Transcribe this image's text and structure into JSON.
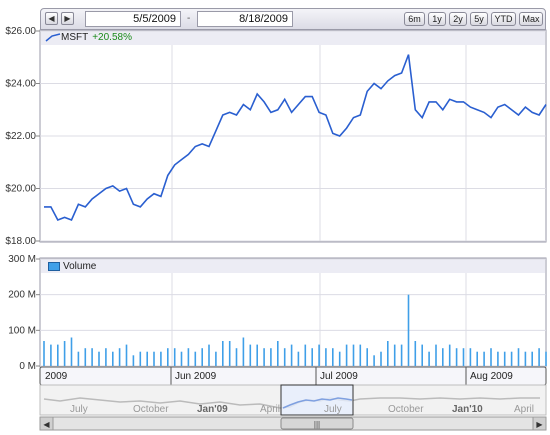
{
  "toolbar": {
    "prev_icon": "left-arrow",
    "next_icon": "right-arrow",
    "start_date": "5/5/2009",
    "end_date": "8/18/2009",
    "separator": "-",
    "ranges": [
      "6m",
      "1y",
      "2y",
      "5y",
      "YTD",
      "Max"
    ]
  },
  "colors": {
    "price_line": "#2a5fd0",
    "volume_bar": "#3f9fe8",
    "change_positive": "#1a8a1a"
  },
  "price_legend": {
    "symbol": "MSFT",
    "change": "+20.58%"
  },
  "volume_legend": {
    "label": "Volume"
  },
  "chart_data": [
    {
      "type": "line",
      "series": [
        {
          "name": "MSFT",
          "x": [
            "5/5",
            "5/6",
            "5/7",
            "5/8",
            "5/11",
            "5/12",
            "5/13",
            "5/14",
            "5/15",
            "5/18",
            "5/19",
            "5/20",
            "5/21",
            "5/22",
            "5/26",
            "5/27",
            "5/28",
            "5/29",
            "6/1",
            "6/2",
            "6/3",
            "6/4",
            "6/5",
            "6/8",
            "6/9",
            "6/10",
            "6/11",
            "6/12",
            "6/15",
            "6/16",
            "6/17",
            "6/18",
            "6/19",
            "6/22",
            "6/23",
            "6/24",
            "6/25",
            "6/26",
            "6/29",
            "6/30",
            "7/1",
            "7/2",
            "7/6",
            "7/7",
            "7/8",
            "7/9",
            "7/10",
            "7/13",
            "7/14",
            "7/15",
            "7/16",
            "7/17",
            "7/20",
            "7/21",
            "7/22",
            "7/23",
            "7/24",
            "7/27",
            "7/28",
            "7/29",
            "7/30",
            "7/31",
            "8/3",
            "8/4",
            "8/5",
            "8/6",
            "8/7",
            "8/10",
            "8/11",
            "8/12",
            "8/13",
            "8/14",
            "8/17",
            "8/18"
          ],
          "values": [
            19.3,
            19.3,
            18.8,
            18.9,
            18.8,
            19.4,
            19.3,
            19.6,
            19.8,
            20.0,
            20.1,
            19.9,
            20.0,
            19.4,
            19.3,
            19.6,
            19.8,
            19.7,
            20.5,
            20.9,
            21.1,
            21.3,
            21.6,
            21.7,
            21.6,
            22.2,
            22.8,
            22.9,
            22.8,
            23.2,
            23.0,
            23.6,
            23.3,
            22.9,
            23.0,
            23.4,
            22.9,
            23.2,
            23.5,
            23.5,
            22.9,
            22.8,
            22.1,
            22.0,
            22.3,
            22.7,
            22.8,
            23.7,
            24.0,
            23.8,
            24.1,
            24.3,
            24.4,
            25.1,
            23.0,
            22.7,
            23.3,
            23.3,
            23.0,
            23.4,
            23.3,
            23.3,
            23.1,
            23.0,
            22.9,
            22.7,
            23.1,
            23.2,
            23.0,
            22.8,
            23.1,
            22.9,
            22.8,
            23.2
          ]
        }
      ],
      "ylim": [
        18.0,
        26.0
      ],
      "ytick_labels": [
        "$18.00",
        "$20.00",
        "$22.00",
        "$24.00",
        "$26.00"
      ],
      "grid": true
    },
    {
      "type": "bar",
      "series": [
        {
          "name": "Volume",
          "values": [
            70,
            60,
            60,
            70,
            80,
            40,
            50,
            50,
            40,
            50,
            40,
            50,
            60,
            30,
            40,
            40,
            40,
            40,
            50,
            50,
            40,
            50,
            40,
            50,
            60,
            40,
            70,
            70,
            50,
            80,
            60,
            60,
            50,
            50,
            70,
            50,
            60,
            40,
            60,
            50,
            60,
            50,
            50,
            40,
            60,
            60,
            60,
            50,
            30,
            40,
            70,
            60,
            60,
            200,
            70,
            60,
            40,
            60,
            50,
            60,
            50,
            50,
            50,
            40,
            40,
            50,
            40,
            40,
            40,
            50,
            40,
            40,
            50,
            40
          ]
        }
      ],
      "ylim": [
        0,
        300
      ],
      "ytick_labels": [
        "0 M",
        "100 M",
        "200 M",
        "300 M"
      ]
    },
    {
      "type": "area",
      "timeline_labels": [
        "2009",
        "Jun 2009",
        "Jul 2009",
        "Aug 2009"
      ],
      "navigator_labels": [
        "July",
        "October",
        "Jan'09",
        "April",
        "July",
        "October",
        "Jan'10",
        "April"
      ]
    }
  ],
  "scrollbar": {
    "left_icon": "left-arrow",
    "right_icon": "right-arrow",
    "thumb_icon": "grip"
  }
}
